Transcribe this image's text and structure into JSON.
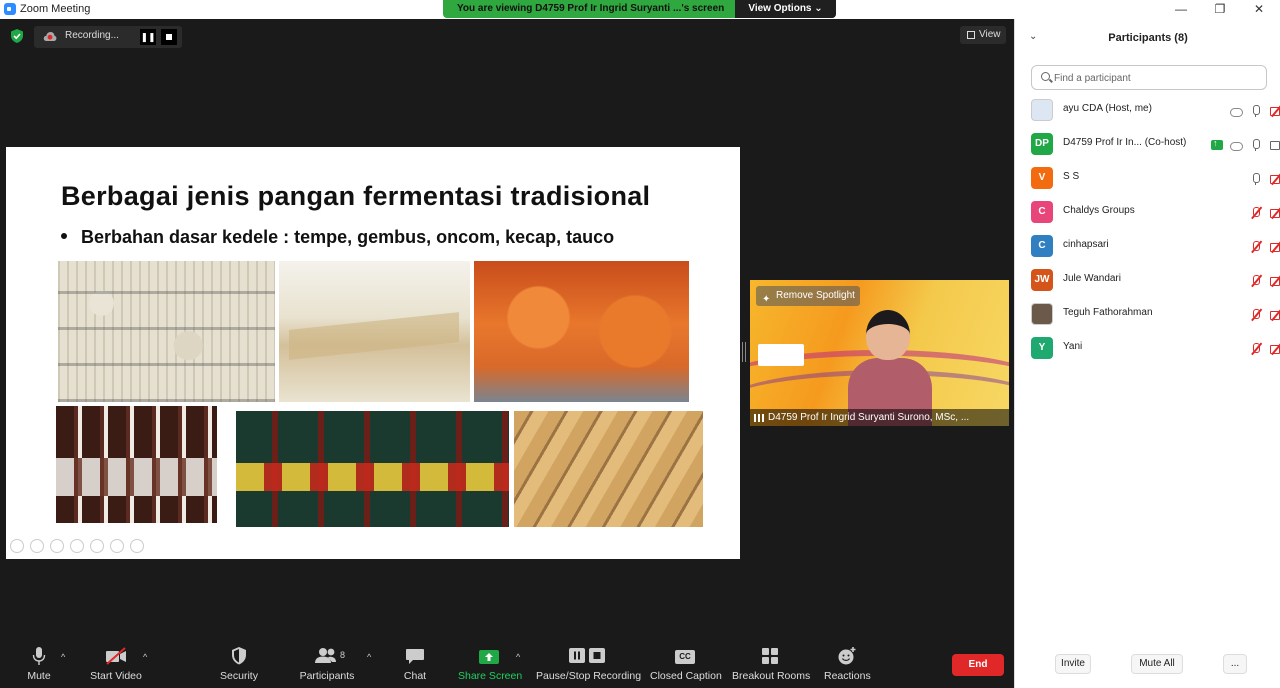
{
  "window": {
    "title": "Zoom Meeting",
    "minimize": "—",
    "restore": "❐",
    "close": "✕"
  },
  "banner": {
    "viewing_text": "You are viewing D4759 Prof Ir Ingrid Suryanti ...'s screen",
    "view_options": "View Options ⌄"
  },
  "meeting_top": {
    "recording_text": "Recording...",
    "pause_glyph": "❚❚",
    "view_label": "View"
  },
  "slide": {
    "title": "Berbagai jenis pangan fermentasi tradisional",
    "bullet": "Berbahan dasar kedele : tempe, gembus, oncom, kecap, tauco"
  },
  "speaker": {
    "remove_spotlight": "Remove Spotlight",
    "name": "D4759 Prof Ir Ingrid Suryanti Surono, MSc, ..."
  },
  "toolbar": {
    "mute": "Mute",
    "start_video": "Start Video",
    "security": "Security",
    "participants": "Participants",
    "participants_count": "8",
    "chat": "Chat",
    "share_screen": "Share Screen",
    "pause_stop_recording": "Pause/Stop Recording",
    "closed_caption": "Closed Caption",
    "closed_caption_glyph": "CC",
    "breakout_rooms": "Breakout Rooms",
    "reactions": "Reactions",
    "end": "End",
    "caret": "^"
  },
  "panel": {
    "title": "Participants (8)",
    "collapse_glyph": "⌄",
    "search_placeholder": "Find a participant",
    "participants": [
      {
        "initials": "",
        "name": "ayu CDA (Host, me)",
        "color": "#ffffff",
        "mic": "on",
        "cam": "off",
        "cloud": true,
        "share": false
      },
      {
        "initials": "DP",
        "name": "D4759 Prof Ir In... (Co-host)",
        "color": "#1fa845",
        "mic": "on",
        "cam": "on",
        "cloud": true,
        "share": true
      },
      {
        "initials": "V",
        "name": "S S",
        "color": "#f36b10",
        "mic": "on",
        "cam": "off",
        "cloud": false,
        "share": false
      },
      {
        "initials": "C",
        "name": "Chaldys Groups",
        "color": "#e8457a",
        "mic": "off",
        "cam": "off",
        "cloud": false,
        "share": false
      },
      {
        "initials": "C",
        "name": "cinhapsari",
        "color": "#2f7fc1",
        "mic": "off",
        "cam": "off",
        "cloud": false,
        "share": false
      },
      {
        "initials": "JW",
        "name": "Jule Wandari",
        "color": "#d5541a",
        "mic": "off",
        "cam": "off",
        "cloud": false,
        "share": false
      },
      {
        "initials": "",
        "name": "Teguh Fathorahman",
        "color": "#6b5a4a",
        "mic": "off",
        "cam": "off",
        "cloud": false,
        "share": false
      },
      {
        "initials": "Y",
        "name": "Yani",
        "color": "#1fa870",
        "mic": "off",
        "cam": "off",
        "cloud": false,
        "share": false
      }
    ],
    "invite": "Invite",
    "mute_all": "Mute All",
    "more": "..."
  }
}
